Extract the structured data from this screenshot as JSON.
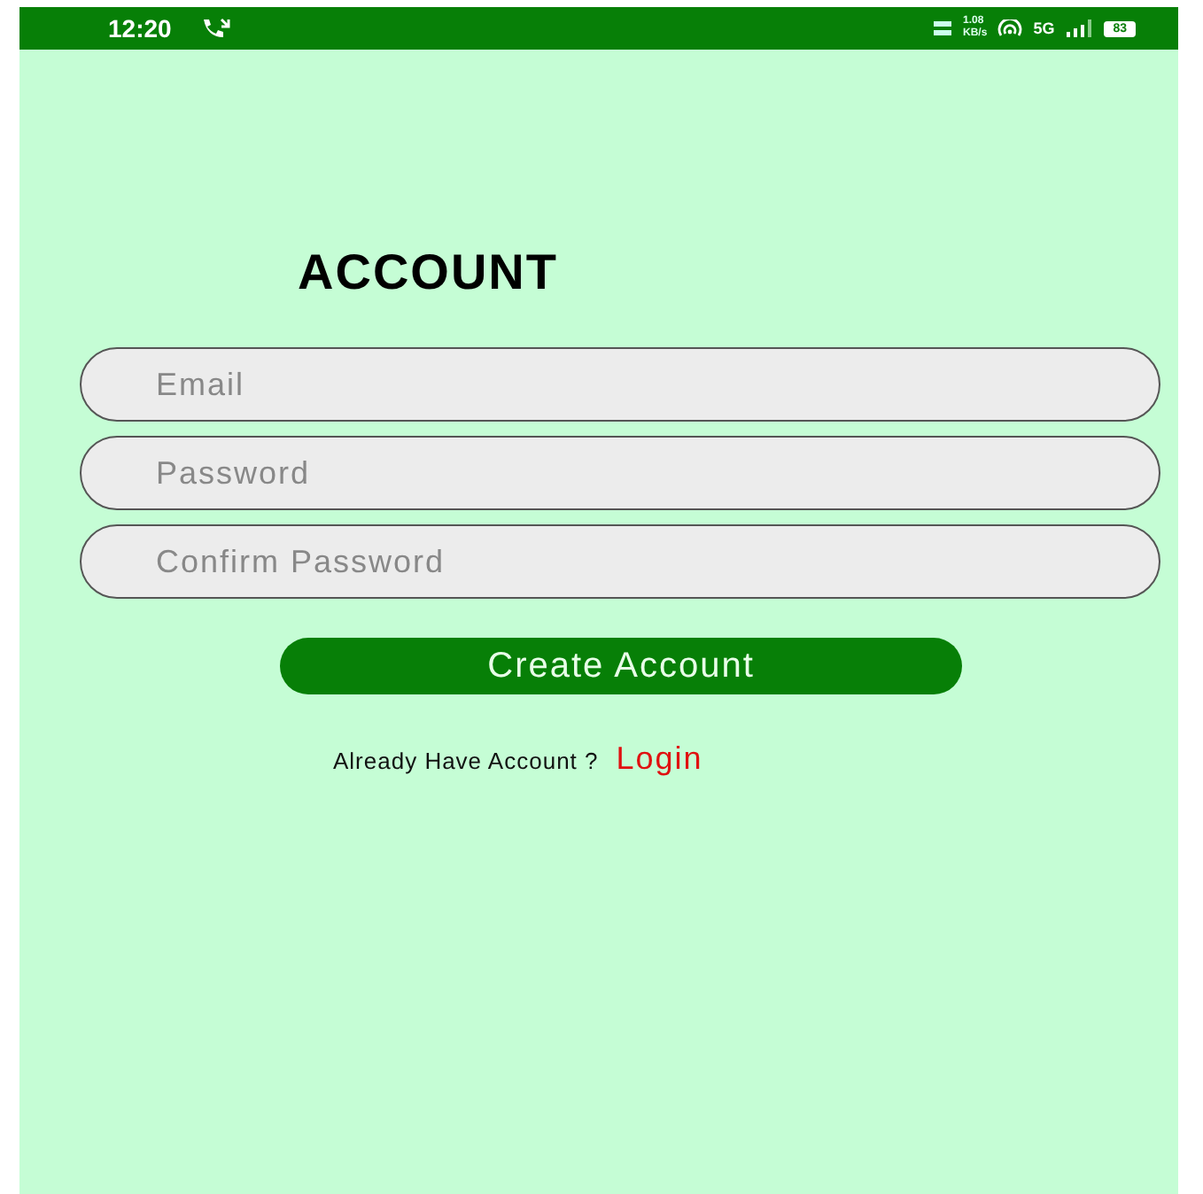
{
  "status_bar": {
    "time": "12:20",
    "net_speed": [
      "1.08",
      "KB/s"
    ],
    "network": "5G",
    "battery": "83"
  },
  "title": "ACCOUNT",
  "fields": [
    {
      "placeholder": "Email"
    },
    {
      "placeholder": "Password"
    },
    {
      "placeholder": "Confirm Password"
    }
  ],
  "button": "Create Account",
  "footer": {
    "text": "Already Have Account ?",
    "link": "Login"
  }
}
